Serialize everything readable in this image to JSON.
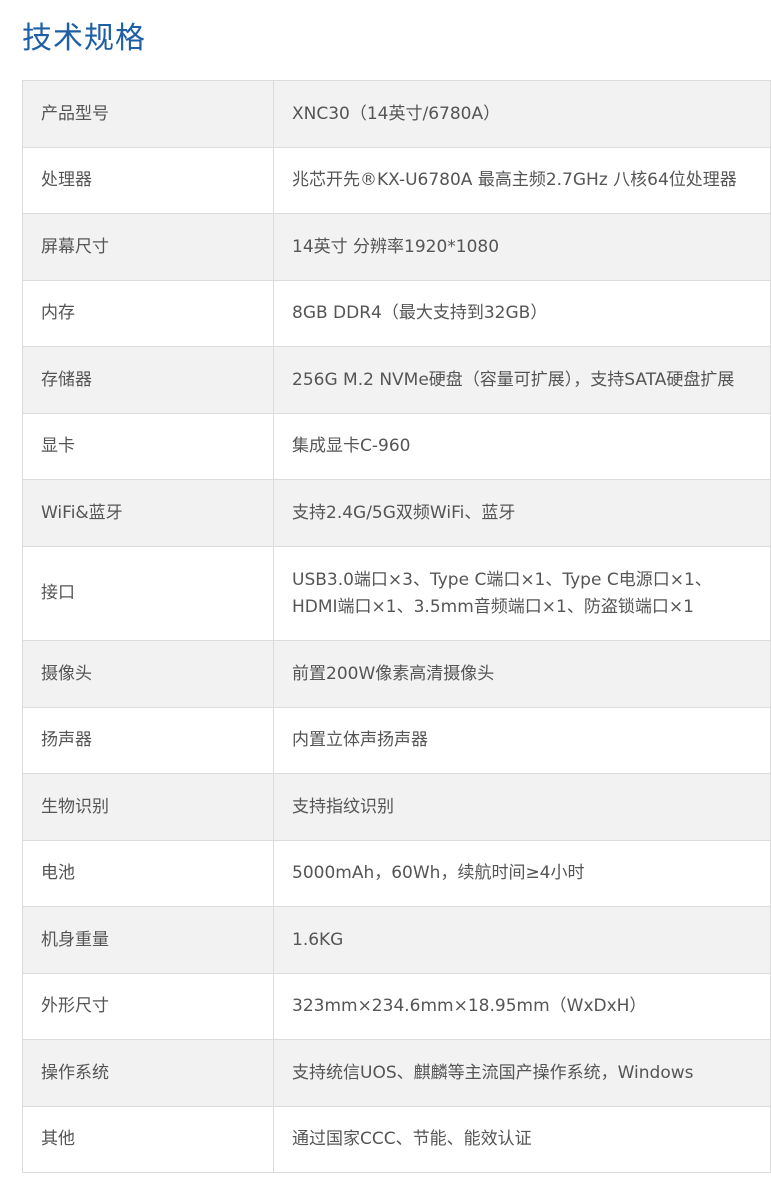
{
  "title": "技术规格",
  "specs": [
    {
      "label": "产品型号",
      "value": "XNC30（14英寸/6780A）"
    },
    {
      "label": "处理器",
      "value": "兆芯开先®KX-U6780A 最高主频2.7GHz 八核64位处理器"
    },
    {
      "label": "屏幕尺寸",
      "value": "14英寸 分辨率1920*1080"
    },
    {
      "label": "内存",
      "value": "8GB DDR4（最大支持到32GB）"
    },
    {
      "label": "存储器",
      "value": "256G M.2 NVMe硬盘（容量可扩展），支持SATA硬盘扩展"
    },
    {
      "label": "显卡",
      "value": "集成显卡C-960"
    },
    {
      "label": "WiFi&蓝牙",
      "value": "支持2.4G/5G双频WiFi、蓝牙"
    },
    {
      "label": "接口",
      "value": "USB3.0端口×3、Type C端口×1、Type C电源口×1、HDMI端口×1、3.5mm音频端口×1、防盗锁端口×1"
    },
    {
      "label": "摄像头",
      "value": "前置200W像素高清摄像头"
    },
    {
      "label": "扬声器",
      "value": "内置立体声扬声器"
    },
    {
      "label": "生物识别",
      "value": "支持指纹识别"
    },
    {
      "label": "电池",
      "value": "5000mAh，60Wh，续航时间≥4小时"
    },
    {
      "label": "机身重量",
      "value": "1.6KG"
    },
    {
      "label": "外形尺寸",
      "value": "323mm×234.6mm×18.95mm（WxDxH）"
    },
    {
      "label": "操作系统",
      "value": "支持统信UOS、麒麟等主流国产操作系统，Windows"
    },
    {
      "label": "其他",
      "value": "通过国家CCC、节能、能效认证"
    }
  ]
}
